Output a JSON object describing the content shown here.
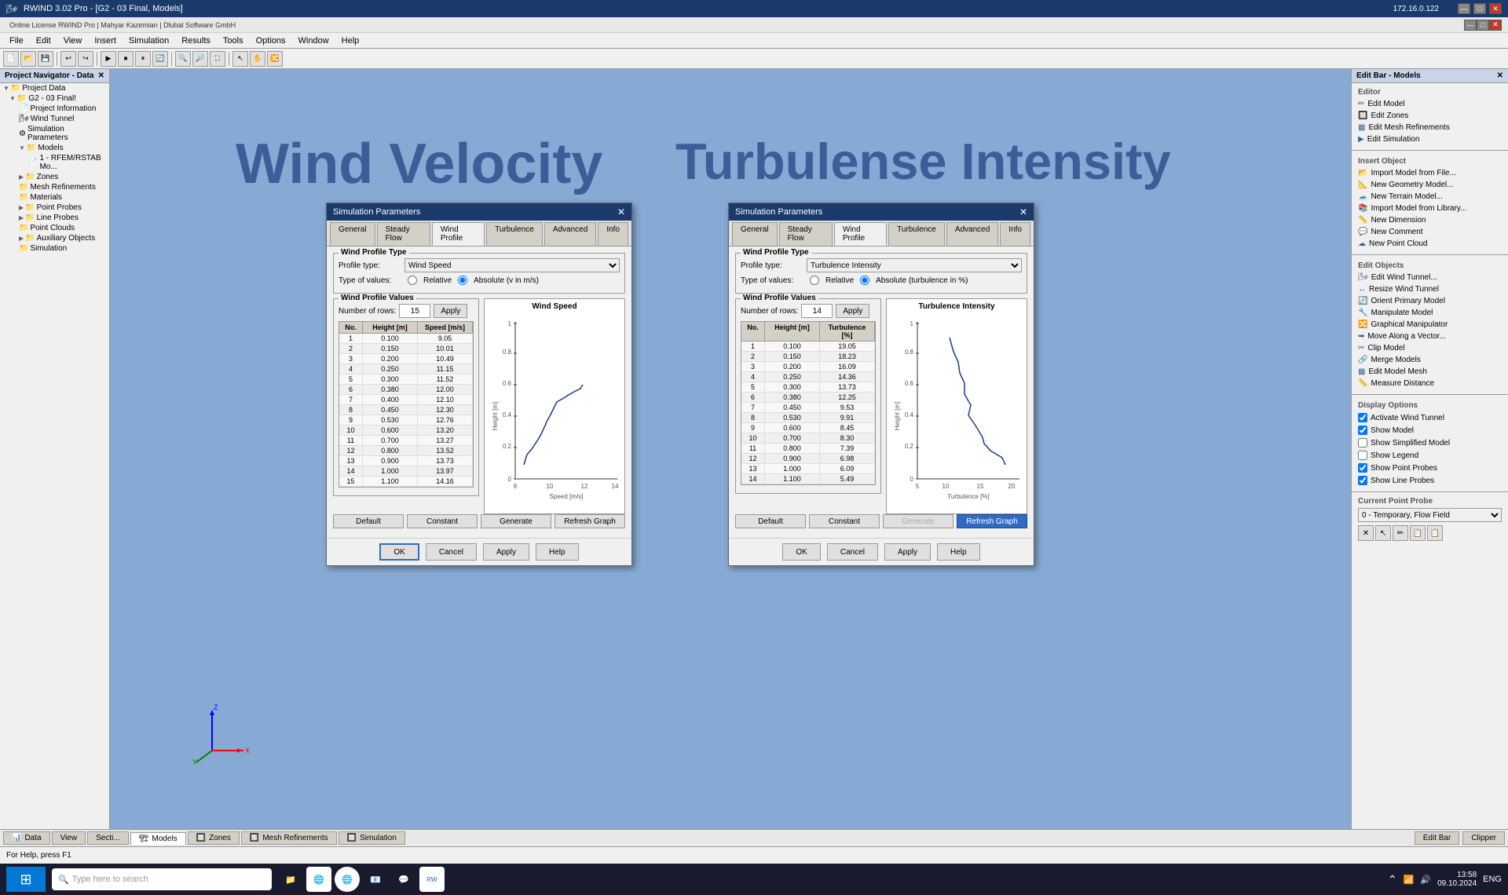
{
  "app": {
    "title": "RWIND 3.02 Pro - [G2 - 03 Final, Models]",
    "license": "Online License RWIND Pro | Mahyar Kazemian | Dlubal Software GmbH",
    "ip": "172.16.0.122"
  },
  "menu": {
    "items": [
      "File",
      "Edit",
      "View",
      "Insert",
      "Simulation",
      "Results",
      "Tools",
      "Options",
      "Window",
      "Help"
    ]
  },
  "left_panel": {
    "header": "Project Navigator - Data",
    "tree": [
      {
        "label": "Project Data",
        "level": 0,
        "icon": "📁"
      },
      {
        "label": "G2 - 03 Final",
        "level": 1,
        "icon": "📁"
      },
      {
        "label": "Project Information",
        "level": 2,
        "icon": "📄"
      },
      {
        "label": "Wind Tunnel",
        "level": 2,
        "icon": "🌬"
      },
      {
        "label": "Simulation Parameters",
        "level": 2,
        "icon": "⚙"
      },
      {
        "label": "Models",
        "level": 2,
        "icon": "📁"
      },
      {
        "label": "1 - RFEM/RSTAB Mo...",
        "level": 3,
        "icon": "📄"
      },
      {
        "label": "Zones",
        "level": 2,
        "icon": "📁"
      },
      {
        "label": "Mesh Refinements",
        "level": 2,
        "icon": "📁"
      },
      {
        "label": "Materials",
        "level": 2,
        "icon": "📁"
      },
      {
        "label": "Point Probes",
        "level": 2,
        "icon": "📁"
      },
      {
        "label": "Line Probes",
        "level": 2,
        "icon": "📁"
      },
      {
        "label": "Point Clouds",
        "level": 2,
        "icon": "📁"
      },
      {
        "label": "Auxiliary Objects",
        "level": 2,
        "icon": "📁"
      },
      {
        "label": "Simulation",
        "level": 2,
        "icon": "📁"
      }
    ]
  },
  "right_panel": {
    "header": "Edit Bar - Models",
    "editor_label": "Editor",
    "editor_items": [
      {
        "label": "Edit Model",
        "icon": "✏"
      },
      {
        "label": "Edit Zones",
        "icon": "🔲"
      },
      {
        "label": "Edit Mesh Refinements",
        "icon": "▦"
      },
      {
        "label": "Edit Simulation",
        "icon": "▶"
      }
    ],
    "insert_label": "Insert Object",
    "insert_items": [
      {
        "label": "Import Model from File...",
        "icon": "📂"
      },
      {
        "label": "New Geometry Model...",
        "icon": "📐"
      },
      {
        "label": "New Terrain Model...",
        "icon": "🗻"
      },
      {
        "label": "Import Model from Library...",
        "icon": "📚"
      },
      {
        "label": "New Dimension",
        "icon": "📏"
      },
      {
        "label": "New Comment",
        "icon": "💬"
      },
      {
        "label": "New Point Cloud",
        "icon": "☁"
      }
    ],
    "edit_objects_label": "Edit Objects",
    "edit_objects_items": [
      {
        "label": "Edit Wind Tunnel...",
        "icon": "🌬"
      },
      {
        "label": "Resize Wind Tunnel",
        "icon": "↔"
      },
      {
        "label": "Orient Primary Model",
        "icon": "🔄"
      },
      {
        "label": "Manipulate Model",
        "icon": "🔧"
      },
      {
        "label": "Graphical Manipulator",
        "icon": "🔀"
      },
      {
        "label": "Move Along a Vector...",
        "icon": "➡"
      },
      {
        "label": "Clip Model",
        "icon": "✂"
      },
      {
        "label": "Merge Models",
        "icon": "🔗"
      },
      {
        "label": "Edit Model Mesh",
        "icon": "▦"
      },
      {
        "label": "Measure Distance",
        "icon": "📏"
      }
    ],
    "display_label": "Display Options",
    "display_items": [
      {
        "label": "Activate Wind Tunnel",
        "checked": true
      },
      {
        "label": "Show Model",
        "checked": true
      },
      {
        "label": "Show Simplified Model",
        "checked": false
      },
      {
        "label": "Show Legend",
        "checked": false
      },
      {
        "label": "Show Point Probes",
        "checked": true
      },
      {
        "label": "Show Line Probes",
        "checked": true
      }
    ],
    "probe_label": "Current Point Probe",
    "probe_value": "0 - Temporary, Flow Field"
  },
  "viewport": {
    "wind_velocity_title": "Wind Velocity",
    "turbulence_title": "Turbulense Intensity"
  },
  "dialog1": {
    "title": "Simulation Parameters",
    "tabs": [
      "General",
      "Steady Flow",
      "Wind Profile",
      "Turbulence",
      "Advanced",
      "Info"
    ],
    "active_tab": "Wind Profile",
    "profile_type_label": "Wind Profile Type",
    "profile_type": "Wind Speed",
    "type_of_values_label": "Type of values:",
    "relative_label": "Relative",
    "absolute_label": "Absolute (v in m/s)",
    "absolute_selected": true,
    "values_label": "Wind Profile Values",
    "num_rows_label": "Number of rows:",
    "num_rows": "15",
    "apply_rows_label": "Apply",
    "graph_title": "Wind Speed",
    "x_axis_label": "Speed [m/s]",
    "y_axis_label": "Height [m]",
    "table_headers": [
      "No.",
      "Height [m]",
      "Speed [m/s]"
    ],
    "table_data": [
      [
        1,
        0.1,
        9.05
      ],
      [
        2,
        0.15,
        10.01
      ],
      [
        3,
        0.2,
        10.49
      ],
      [
        4,
        0.25,
        11.15
      ],
      [
        5,
        0.3,
        11.52
      ],
      [
        6,
        0.38,
        12.0
      ],
      [
        7,
        0.4,
        12.1
      ],
      [
        8,
        0.45,
        12.3
      ],
      [
        9,
        0.53,
        12.76
      ],
      [
        10,
        0.6,
        13.2
      ],
      [
        11,
        0.7,
        13.27
      ],
      [
        12,
        0.8,
        13.52
      ],
      [
        13,
        0.9,
        13.73
      ],
      [
        14,
        1.0,
        13.97
      ],
      [
        15,
        1.1,
        14.16
      ]
    ],
    "btns": [
      "Default",
      "Constant",
      "Generate",
      "Refresh Graph"
    ],
    "footer_btns": [
      "OK",
      "Cancel",
      "Apply",
      "Help"
    ]
  },
  "dialog2": {
    "title": "Simulation Parameters",
    "tabs": [
      "General",
      "Steady Flow",
      "Wind Profile",
      "Turbulence",
      "Advanced",
      "Info"
    ],
    "active_tab": "Wind Profile",
    "profile_type_label": "Wind Profile Type",
    "profile_type": "Turbulence Intensity",
    "type_of_values_label": "Type of values:",
    "relative_label": "Relative",
    "absolute_label": "Absolute (turbulence in %)",
    "absolute_selected": true,
    "values_label": "Wind Profile Values",
    "num_rows_label": "Number of rows:",
    "num_rows": "14",
    "apply_rows_label": "Apply",
    "graph_title": "Turbulence Intensity",
    "x_axis_label": "Turbulence [%]",
    "y_axis_label": "Height [m]",
    "table_headers": [
      "No.",
      "Height [m]",
      "Turbulence [%]"
    ],
    "table_data": [
      [
        1,
        0.1,
        19.05
      ],
      [
        2,
        0.15,
        18.23
      ],
      [
        3,
        0.2,
        16.09
      ],
      [
        4,
        0.25,
        14.36
      ],
      [
        5,
        0.3,
        13.73
      ],
      [
        6,
        0.38,
        12.25
      ],
      [
        7,
        0.45,
        9.53
      ],
      [
        8,
        0.53,
        9.91
      ],
      [
        9,
        0.6,
        8.45
      ],
      [
        10,
        0.7,
        8.3
      ],
      [
        11,
        0.8,
        7.39
      ],
      [
        12,
        0.9,
        6.98
      ],
      [
        13,
        1.0,
        6.09
      ],
      [
        14,
        1.1,
        5.49
      ]
    ],
    "btns": [
      "Default",
      "Constant",
      "Generate",
      "Refresh Graph"
    ],
    "footer_btns": [
      "OK",
      "Cancel",
      "Apply",
      "Help"
    ]
  },
  "bottom_tabs": {
    "tabs": [
      "Data",
      "View",
      "Secti...",
      "Models",
      "Zones",
      "Mesh Refinements",
      "Simulation"
    ]
  },
  "status_bar": {
    "text": "For Help, press F1"
  },
  "taskbar": {
    "time": "13:58",
    "date": "09.10.2024",
    "language": "ENG",
    "search_placeholder": "Type here to search"
  }
}
